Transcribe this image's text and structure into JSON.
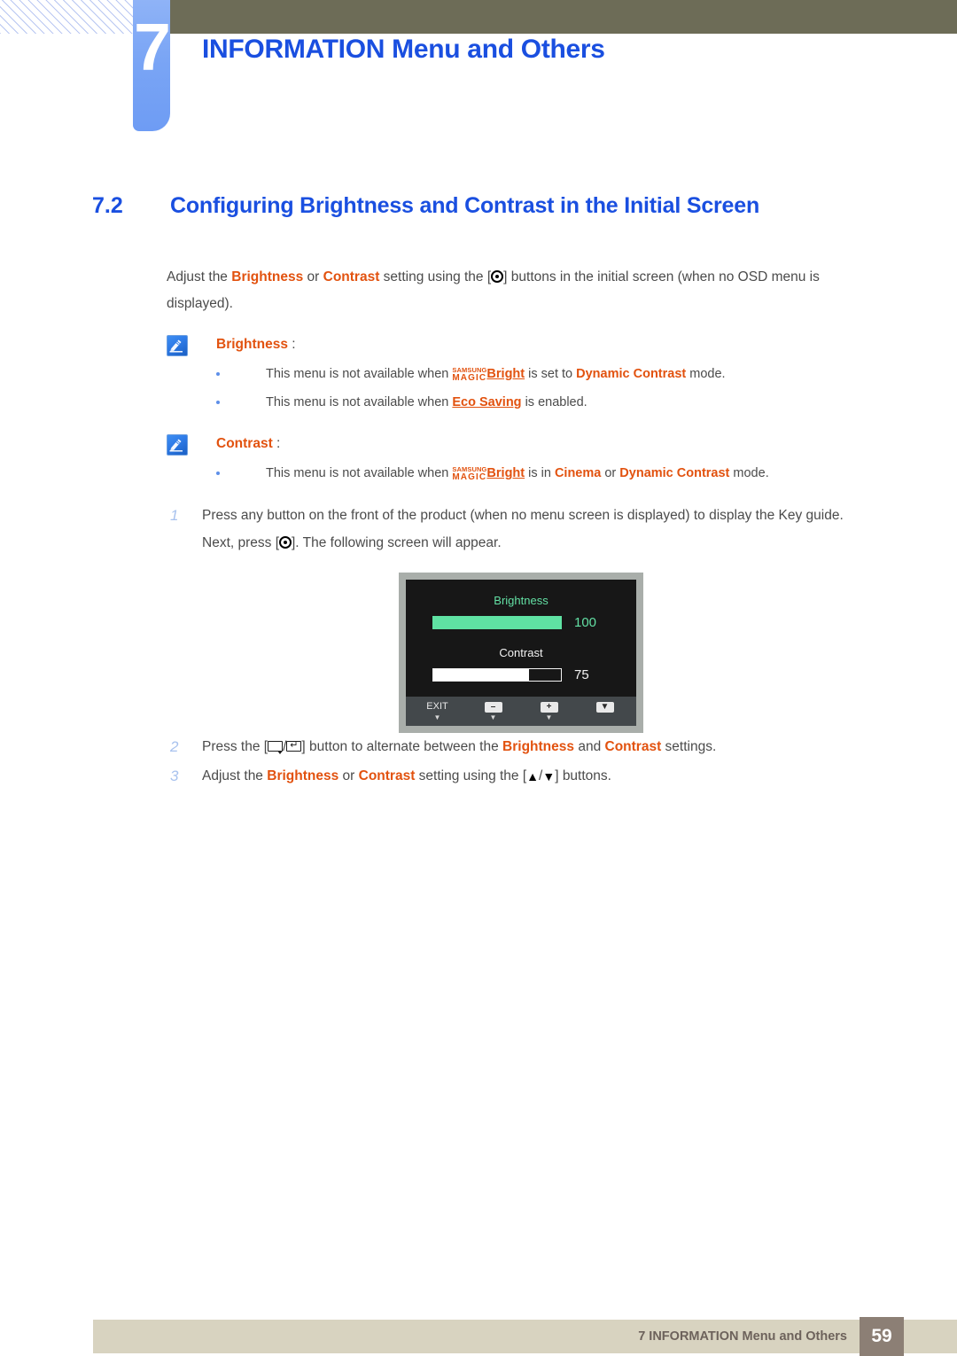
{
  "header": {
    "chapter_number": "7",
    "chapter_title": "INFORMATION Menu and Others"
  },
  "section": {
    "number": "7.2",
    "title": "Configuring Brightness and Contrast in the Initial Screen"
  },
  "intro": {
    "t1": "Adjust the ",
    "brightness": "Brightness",
    "t2": " or ",
    "contrast": "Contrast",
    "t3": " setting using the [",
    "t4": "] buttons in the initial screen (when no OSD menu is displayed)."
  },
  "notes": [
    {
      "title": "Brightness",
      "colon": " :",
      "bullets": [
        {
          "pre": "This menu is not available when ",
          "magic_top": "SAMSUNG",
          "magic_bottom": "MAGIC",
          "magic_word": "Bright",
          "mid": " is set to ",
          "mode": "Dynamic Contrast",
          "post": " mode."
        },
        {
          "pre": "This menu is not available when ",
          "term": "Eco Saving",
          "post": " is enabled."
        }
      ]
    },
    {
      "title": "Contrast",
      "colon": " :",
      "bullets": [
        {
          "pre": "This menu is not available when ",
          "magic_top": "SAMSUNG",
          "magic_bottom": "MAGIC",
          "magic_word": "Bright",
          "mid": " is in ",
          "mode1": "Cinema",
          "conj": " or ",
          "mode2": "Dynamic Contrast",
          "post": " mode."
        }
      ]
    }
  ],
  "steps": {
    "one": {
      "index": "1",
      "t1": "Press any button on the front of the product (when no menu screen is displayed) to display the Key guide. Next, press [",
      "t2": "]. The following screen will appear."
    },
    "two": {
      "index": "2",
      "t1": "Press the [",
      "slash": "/",
      "t2": "] button to alternate between the ",
      "brightness": "Brightness",
      "t3": " and ",
      "contrast": "Contrast",
      "t4": " settings."
    },
    "three": {
      "index": "3",
      "t1": "Adjust the ",
      "brightness": "Brightness",
      "t2": " or ",
      "contrast": "Contrast",
      "t3": " setting using the [",
      "up": "▲",
      "slash": "/",
      "down": "▼",
      "t4": "] buttons."
    }
  },
  "osd": {
    "brightness_label": "Brightness",
    "brightness_value": "100",
    "brightness_percent": 100,
    "contrast_label": "Contrast",
    "contrast_value": "75",
    "contrast_percent": 75,
    "keys": [
      {
        "glyph": "EXIT",
        "sub": "▼",
        "type": "text"
      },
      {
        "glyph": "–",
        "sub": "▼",
        "type": "box"
      },
      {
        "glyph": "+",
        "sub": "▼",
        "type": "box"
      },
      {
        "glyph": "▼",
        "sub": "",
        "type": "box"
      }
    ]
  },
  "footer": {
    "text": "7 INFORMATION Menu and Others",
    "page": "59"
  },
  "colors": {
    "accent_blue": "#1a4fe0",
    "tab_blue": "#7aa5f5",
    "olive": "#6d6c57",
    "orange": "#e2520f",
    "footer_bar": "#d8d3c0",
    "footer_page_box": "#8c7f75",
    "osd_green": "#63e0a4"
  }
}
